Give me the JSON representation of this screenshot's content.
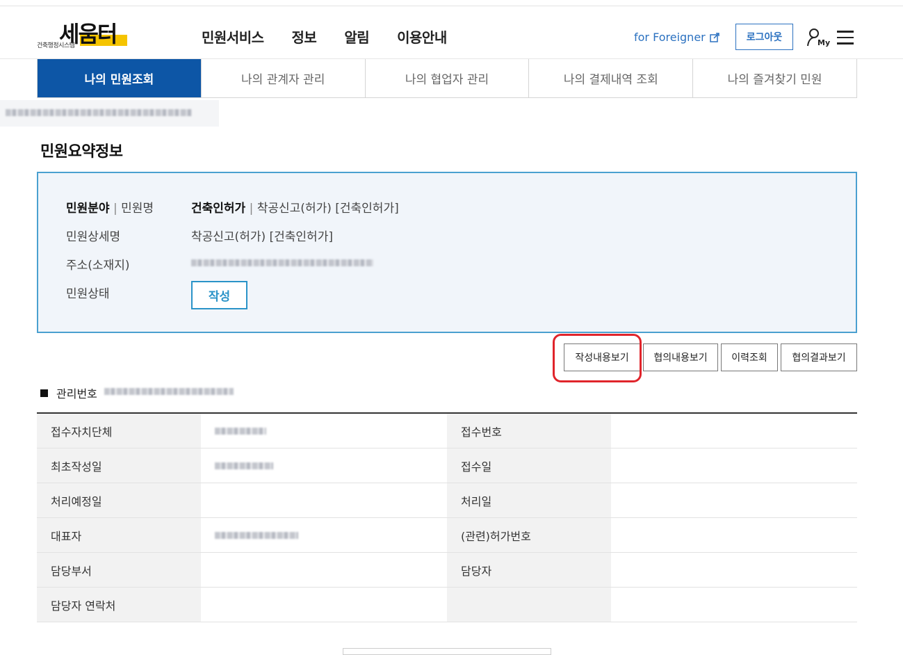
{
  "header": {
    "logo_main": "세움터",
    "logo_sub": "건축행정시스템",
    "nav": [
      "민원서비스",
      "정보",
      "알림",
      "이용안내"
    ],
    "foreigner_link": "for Foreigner",
    "logout_label": "로그아웃",
    "my_label": "My"
  },
  "tabs": [
    {
      "label": "나의 민원조회",
      "active": true
    },
    {
      "label": "나의 관계자 관리",
      "active": false
    },
    {
      "label": "나의 협업자 관리",
      "active": false
    },
    {
      "label": "나의 결제내역 조회",
      "active": false
    },
    {
      "label": "나의 즐겨찾기 민원",
      "active": false
    }
  ],
  "section_title": "민원요약정보",
  "summary": {
    "field_label_bold": "민원분야",
    "field_label_rest": "민원명",
    "field_value_bold": "건축인허가",
    "field_value_rest": "착공신고(허가) [건축인허가]",
    "detail_label": "민원상세명",
    "detail_value": "착공신고(허가) [건축인허가]",
    "address_label": "주소(소재지)",
    "status_label": "민원상태",
    "status_value": "작성"
  },
  "actions": [
    "작성내용보기",
    "협의내용보기",
    "이력조회",
    "협의결과보기"
  ],
  "management_label": "관리번호",
  "table": [
    {
      "l1": "접수자치단체",
      "l2": "접수번호"
    },
    {
      "l1": "최초작성일",
      "l2": "접수일"
    },
    {
      "l1": "처리예정일",
      "l2": "처리일"
    },
    {
      "l1": "대표자",
      "l2": "(관련)허가번호"
    },
    {
      "l1": "담당부서",
      "l2": "담당자"
    },
    {
      "l1": "담당자 연락처",
      "l2": ""
    }
  ],
  "colors": {
    "primary": "#0d56a6",
    "accent": "#2a93c8",
    "highlight": "#e0242b"
  }
}
